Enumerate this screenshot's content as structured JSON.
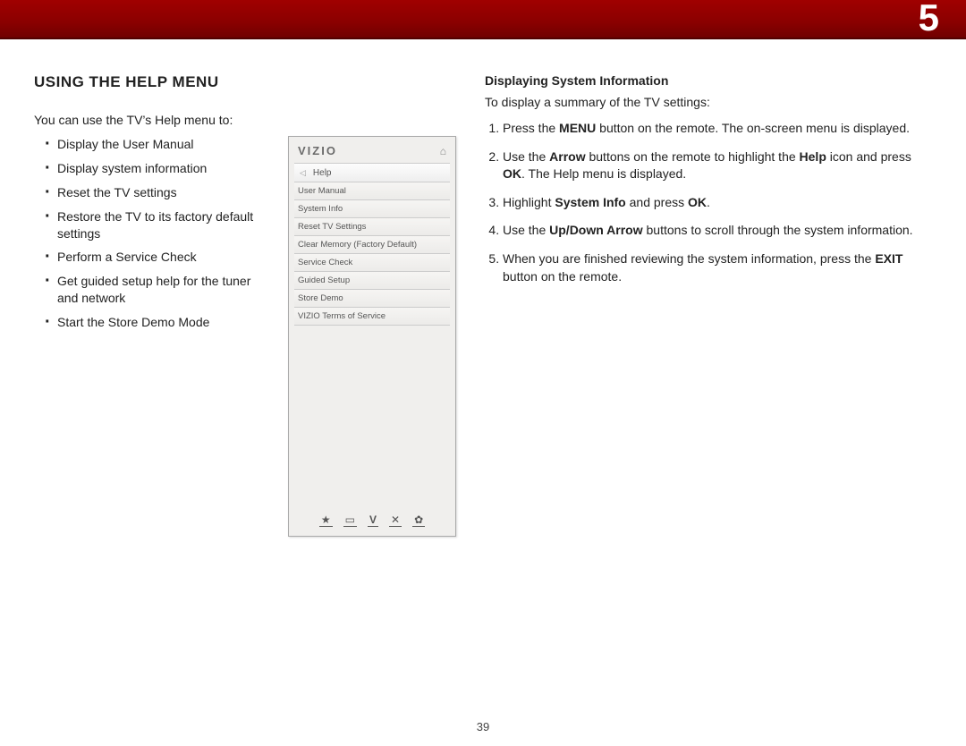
{
  "chapter_number": "5",
  "page_number": "39",
  "left": {
    "heading": "USING THE HELP MENU",
    "intro": "You can use the TV’s Help menu to:",
    "bullets": [
      "Display the User Manual",
      "Display system information",
      "Reset the TV settings",
      "Restore the TV to its factory default settings",
      "Perform a Service Check",
      "Get guided setup help for the tuner and network",
      "Start the Store Demo Mode"
    ]
  },
  "osd": {
    "logo": "VIZIO",
    "breadcrumb": "Help",
    "items": [
      "User Manual",
      "System Info",
      "Reset TV Settings",
      "Clear Memory (Factory Default)",
      "Service Check",
      "Guided Setup",
      "Store Demo",
      "VIZIO Terms of Service"
    ]
  },
  "right": {
    "subhead": "Displaying System Information",
    "lead": "To display a summary of the TV settings:",
    "steps_html": [
      "Press the <b>MENU</b> button on the remote. The on-screen menu is displayed.",
      "Use the <b>Arrow</b> buttons on the remote to highlight the <b>Help</b> icon and press <b>OK</b>. The Help menu is displayed.",
      "Highlight <b>System Info</b> and press <b>OK</b>.",
      "Use the <b>Up/Down Arrow</b> buttons to scroll through the system information.",
      "When you are finished reviewing the system information, press the <b>EXIT</b> button on the remote."
    ]
  }
}
